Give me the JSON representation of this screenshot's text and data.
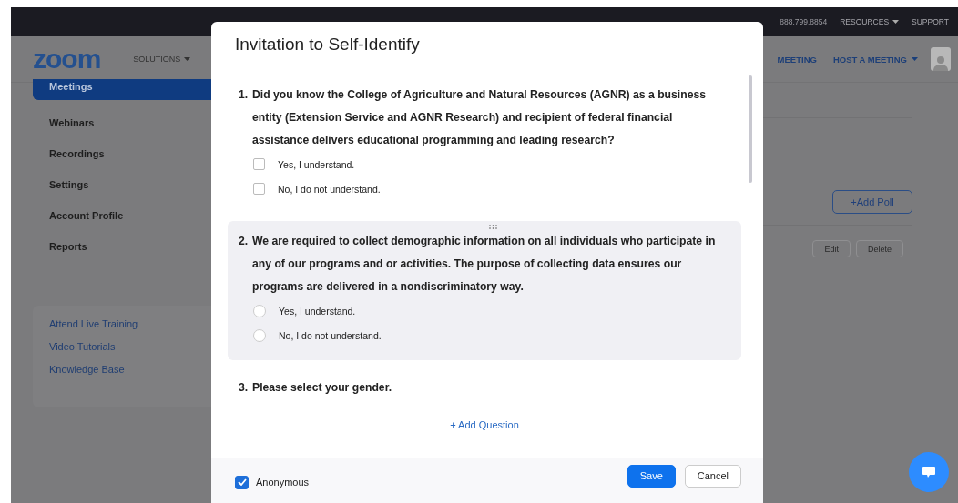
{
  "top_bar": {
    "phone": "888.799.8854",
    "links": [
      {
        "label": "RESOURCES",
        "dropdown": true
      },
      {
        "label": "SUPPORT",
        "dropdown": false
      }
    ]
  },
  "header": {
    "logo": "zoom",
    "nav_left": [
      {
        "label": "SOLUTIONS",
        "dropdown": true
      }
    ],
    "nav_right": [
      {
        "label": "MEETING",
        "dropdown": false
      },
      {
        "label": "HOST A MEETING",
        "dropdown": true
      }
    ]
  },
  "sidebar": {
    "items": [
      {
        "label": "Meetings",
        "selected": true
      },
      {
        "label": "Webinars",
        "selected": false
      },
      {
        "label": "Recordings",
        "selected": false
      },
      {
        "label": "Settings",
        "selected": false
      },
      {
        "label": "Account Profile",
        "selected": false
      },
      {
        "label": "Reports",
        "selected": false
      }
    ],
    "help_links": [
      "Attend Live Training",
      "Video Tutorials",
      "Knowledge Base"
    ]
  },
  "content": {
    "add_poll": "+Add Poll",
    "row_buttons": [
      "Edit",
      "Delete"
    ]
  },
  "dialog": {
    "title": "Invitation to Self-Identify",
    "questions": [
      {
        "number": "1.",
        "text": "Did you know the College of Agriculture and Natural Resources (AGNR) as a business entity (Extension Service and AGNR Research) and recipient of federal financial assistance delivers educational programming and leading research?",
        "kind": "checkbox",
        "highlighted": false,
        "options": [
          {
            "label": "Yes, I understand.",
            "checked": false
          },
          {
            "label": "No, I do not understand.",
            "checked": false
          }
        ]
      },
      {
        "number": "2.",
        "text": "We are required to collect demographic information on all individuals who participate in any of our programs and or activities. The purpose of collecting data ensures our programs are delivered in a nondiscriminatory way.",
        "kind": "radio",
        "highlighted": true,
        "options": [
          {
            "label": "Yes, I understand.",
            "checked": false
          },
          {
            "label": "No, I do not understand.",
            "checked": false
          }
        ]
      },
      {
        "number": "3.",
        "text": "Please select your gender.",
        "highlighted": false
      }
    ],
    "add_question": "+ Add Question",
    "anonymous": {
      "label": "Anonymous",
      "checked": true
    },
    "buttons": [
      {
        "label": "Save",
        "kind": "primary"
      },
      {
        "label": "Cancel",
        "kind": "secondary"
      }
    ]
  }
}
